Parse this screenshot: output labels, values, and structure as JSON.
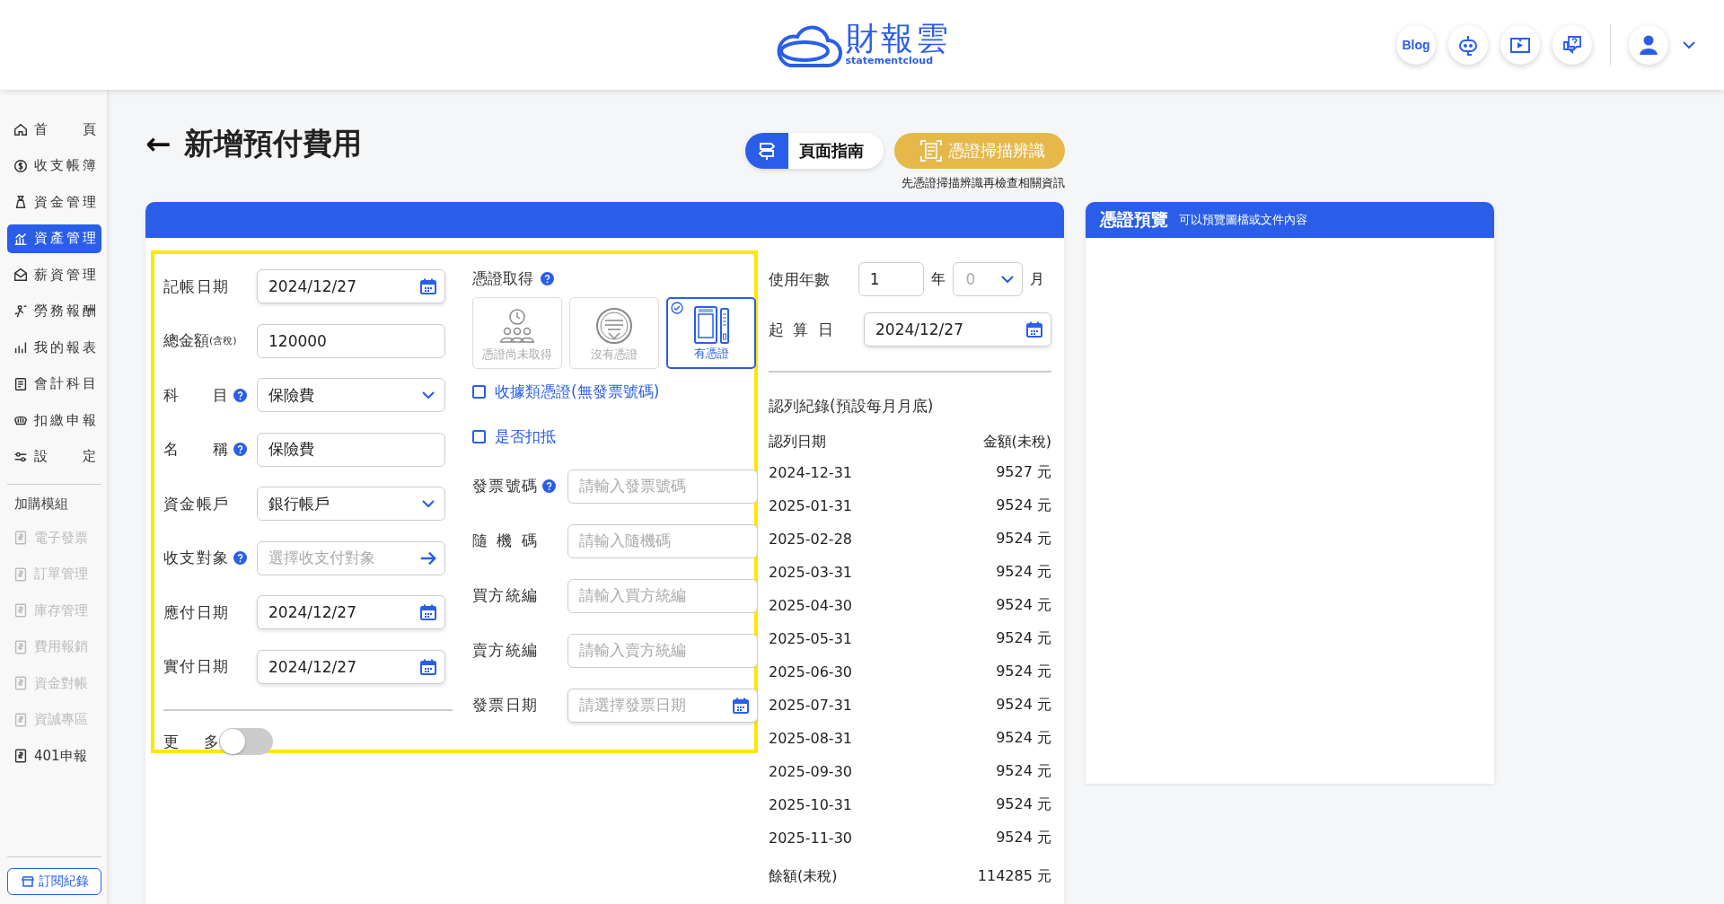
{
  "header": {
    "logo_name": "財報雲",
    "logo_tagline": "statementcloud",
    "blog_button": "Blog"
  },
  "sidebar": {
    "items": [
      {
        "label": "首 頁",
        "selected": false
      },
      {
        "label": "收支帳簿",
        "selected": false
      },
      {
        "label": "資金管理",
        "selected": false
      },
      {
        "label": "資產管理",
        "selected": true
      },
      {
        "label": "薪資管理",
        "selected": false
      },
      {
        "label": "勞務報酬",
        "selected": false
      },
      {
        "label": "我的報表",
        "selected": false
      },
      {
        "label": "會計科目",
        "selected": false
      },
      {
        "label": "扣繳申報",
        "selected": false
      },
      {
        "label": "設 定",
        "selected": false
      }
    ],
    "addons_title": "加購模組",
    "addons": [
      {
        "label": "電子發票",
        "disabled": true
      },
      {
        "label": "訂單管理",
        "disabled": true
      },
      {
        "label": "庫存管理",
        "disabled": true
      },
      {
        "label": "費用報銷",
        "disabled": true
      },
      {
        "label": "資金對帳",
        "disabled": true
      },
      {
        "label": "資誠專區",
        "disabled": true
      },
      {
        "label": "401申報",
        "disabled": false
      }
    ],
    "footer_button": "訂閱紀錄"
  },
  "page": {
    "back_arrow": "←",
    "title": "新增預付費用",
    "guide_button": "頁面指南",
    "scan_button": "憑證掃描辨識",
    "scan_hint": "先憑證掃描辨識再檢查相關資訊"
  },
  "form": {
    "left_fields": [
      {
        "label": "記帳日期",
        "kind": "date",
        "value": "2024/12/27",
        "help": false
      },
      {
        "label": "總金額",
        "label_note": "(含稅)",
        "kind": "text",
        "value": "120000",
        "help": false
      },
      {
        "label": "科 目",
        "kind": "select",
        "value": "保險費",
        "help": true
      },
      {
        "label": "名 稱",
        "kind": "text",
        "value": "保險費",
        "help": true
      },
      {
        "label": "資金帳戶",
        "kind": "select",
        "value": "銀行帳戶",
        "help": false
      },
      {
        "label": "收支對象",
        "kind": "link",
        "placeholder": "選擇收支付對象",
        "help": true
      },
      {
        "label": "應付日期",
        "kind": "date",
        "value": "2024/12/27",
        "help": false
      },
      {
        "label": "實付日期",
        "kind": "date",
        "value": "2024/12/27",
        "help": false
      }
    ],
    "more_toggle": {
      "label": "更 多",
      "on": false
    },
    "voucher": {
      "label": "憑證取得",
      "help": true,
      "options": [
        {
          "label": "憑證尚未取得",
          "kind": "pending",
          "selected": false
        },
        {
          "label": "沒有憑證",
          "kind": "none",
          "selected": false
        },
        {
          "label": "有憑證",
          "kind": "has",
          "selected": true
        }
      ]
    },
    "checkboxes": [
      {
        "label": "收據類憑證(無發票號碼)",
        "checked": false
      },
      {
        "label": "是否扣抵",
        "checked": false
      }
    ],
    "invoice_fields": [
      {
        "label": "發票號碼",
        "kind": "text",
        "placeholder": "請輸入發票號碼",
        "help": true
      },
      {
        "label": "隨 機 碼",
        "kind": "text",
        "placeholder": "請輸入隨機碼",
        "help": false
      },
      {
        "label": "買方統編",
        "kind": "text",
        "placeholder": "請輸入買方統編",
        "help": false
      },
      {
        "label": "賣方統編",
        "kind": "text",
        "placeholder": "請輸入賣方統編",
        "help": false
      },
      {
        "label": "發票日期",
        "kind": "date",
        "placeholder": "請選擇發票日期",
        "help": false
      }
    ]
  },
  "amortization": {
    "years_label": "使用年數",
    "years_value": "1",
    "years_unit": "年",
    "months_value": "0",
    "months_unit": "月",
    "start_label": "起 算 日",
    "start_value": "2024/12/27",
    "records_title": "認列紀錄(預設每月月底)",
    "columns": [
      "認列日期",
      "金額(未稅)"
    ],
    "rows": [
      {
        "date": "2024-12-31",
        "amount": "9527 元"
      },
      {
        "date": "2025-01-31",
        "amount": "9524 元"
      },
      {
        "date": "2025-02-28",
        "amount": "9524 元"
      },
      {
        "date": "2025-03-31",
        "amount": "9524 元"
      },
      {
        "date": "2025-04-30",
        "amount": "9524 元"
      },
      {
        "date": "2025-05-31",
        "amount": "9524 元"
      },
      {
        "date": "2025-06-30",
        "amount": "9524 元"
      },
      {
        "date": "2025-07-31",
        "amount": "9524 元"
      },
      {
        "date": "2025-08-31",
        "amount": "9524 元"
      },
      {
        "date": "2025-09-30",
        "amount": "9524 元"
      },
      {
        "date": "2025-10-31",
        "amount": "9524 元"
      },
      {
        "date": "2025-11-30",
        "amount": "9524 元"
      }
    ],
    "balance_label": "餘額(未稅)",
    "balance_amount": "114285 元"
  },
  "preview": {
    "title": "憑證預覽",
    "subtitle": "可以預覽圖檔或文件內容"
  }
}
